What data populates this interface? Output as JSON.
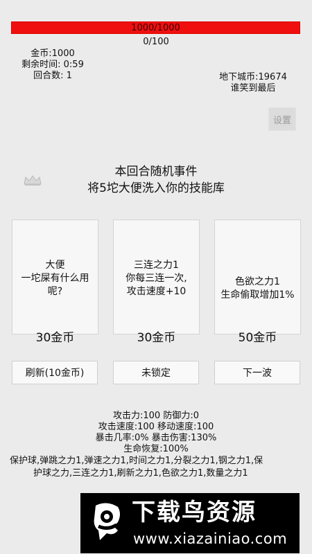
{
  "hud": {
    "hp_text": "1000/1000",
    "progress_text": "0/100",
    "gold": "金币:1000",
    "time_left": "剩余时间:  0:59",
    "round": "回合数:  1",
    "dungeon_coin": "地下城币:19674",
    "slogan": "谁笑到最后",
    "settings_label": "设置"
  },
  "event": {
    "title": "本回合随机事件",
    "description": "将5坨大便洗入你的技能库"
  },
  "cards": [
    {
      "name_line1": "大便",
      "name_line2": "一坨屎有什么用",
      "name_line3": "呢?",
      "price": "30金币"
    },
    {
      "name_line1": "三连之力1",
      "name_line2": "你每三连一次,",
      "name_line3": "攻击速度+10",
      "price": "30金币"
    },
    {
      "name_line1": "色欲之力1",
      "name_line2": "生命偷取增加1%",
      "name_line3": "",
      "price": "50金币"
    }
  ],
  "buttons": {
    "refresh": "刷新(10金币)",
    "lock": "未锁定",
    "next_wave": "下一波"
  },
  "stats": {
    "line1": "攻击力:100 防御力:0",
    "line2": "攻击速度:100 移动速度:100",
    "line3": "暴击几率:0% 暴击伤害:130%",
    "line4": "生命恢复:100%"
  },
  "skills": {
    "line1": "保护球,弹跳之力1,弹速之力1,时间之力1,分裂之力1,钢之力1,保",
    "line2": "护球之力,三连之力1,刷新之力1,色欲之力1,数量之力1"
  },
  "watermark": {
    "title": "下载鸟资源",
    "url": "www.xiazainiao.com"
  },
  "colors": {
    "hp_bar": "#f00f0f",
    "background": "#ebebeb",
    "card_bg": "#f7f7f7"
  }
}
